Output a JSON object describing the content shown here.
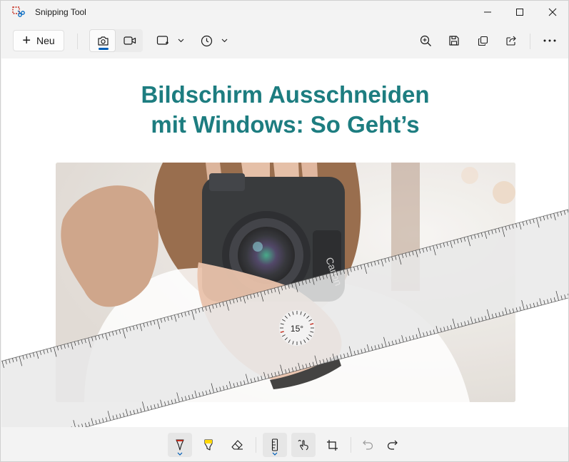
{
  "window": {
    "title": "Snipping Tool",
    "minimize_icon": "minimize-icon",
    "maximize_icon": "maximize-icon",
    "close_icon": "close-icon"
  },
  "toolbar": {
    "new_label": "Neu",
    "modes": [
      "camera-icon",
      "video-icon"
    ],
    "selected_mode": "screenshot",
    "snip_shape_icon": "rectangle-snip-icon",
    "delay_icon": "timer-icon",
    "right_icons": [
      "zoom-in-icon",
      "save-icon",
      "copy-icon",
      "share-icon",
      "more-icon"
    ]
  },
  "content": {
    "headline_line1": "Bildschirm Ausschneiden",
    "headline_line2": "mit Windows: So Geht’s",
    "headline_color": "#1d7d80",
    "image_alt": "photo of person holding camera",
    "ruler_angle": "15°"
  },
  "bottom_toolbar": {
    "tools": [
      "pen-icon",
      "highlighter-icon",
      "eraser-icon",
      "ruler-icon",
      "touch-writing-icon",
      "crop-icon",
      "undo-icon",
      "redo-icon"
    ],
    "pen_color": "#c42b1c",
    "highlighter_color": "#ffd800",
    "accent": "#005fb8"
  }
}
